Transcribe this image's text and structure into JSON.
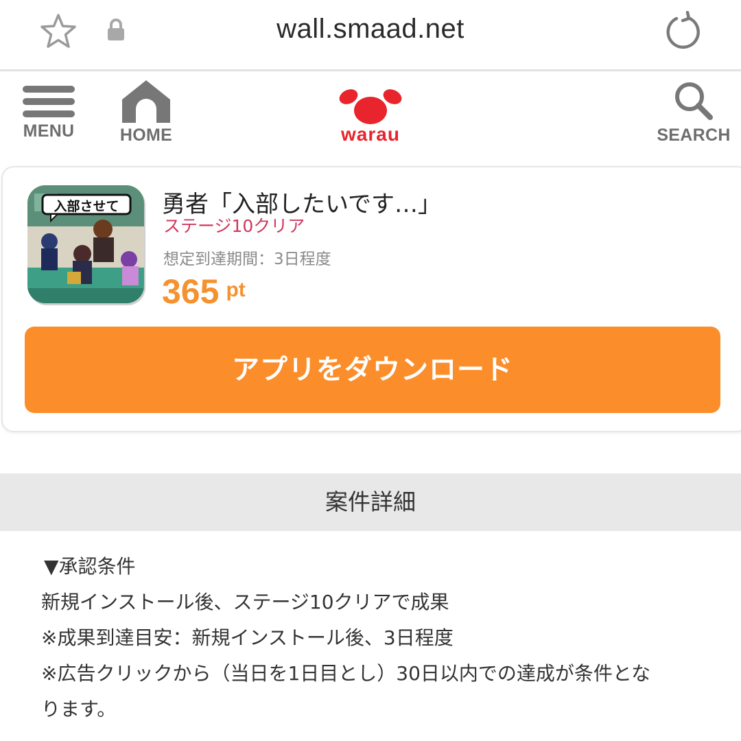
{
  "browser": {
    "url": "wall.smaad.net",
    "icons": {
      "bookmark": "star-outline-icon",
      "secure": "lock-icon",
      "reload": "reload-icon"
    }
  },
  "header": {
    "menu_label": "MENU",
    "home_label": "HOME",
    "search_label": "SEARCH",
    "logo_text": "warau",
    "icons": {
      "menu": "hamburger-icon",
      "home": "home-icon",
      "search": "magnifier-icon"
    }
  },
  "offer": {
    "icon_text": "入部させて",
    "title": "勇者「入部したいです…」",
    "subtitle": "ステージ10クリア",
    "period": "想定到達期間：3日程度",
    "points_value": "365",
    "points_unit": "pt",
    "download_label": "アプリをダウンロード"
  },
  "details": {
    "heading": "案件詳細",
    "lines": [
      "▼承認条件",
      "新規インストール後、ステージ10クリアで成果",
      "※成果到達目安：新規インストール後、3日程度",
      "※広告クリックから（当日を1日目とし）30日以内での達成が条件とな",
      "ります。"
    ]
  },
  "colors": {
    "accent_orange": "#fb8e2b",
    "points_orange": "#f5922f",
    "subtitle_red": "#d0365e",
    "logo_red": "#e8242c",
    "nav_gray": "#6e6e6e"
  }
}
